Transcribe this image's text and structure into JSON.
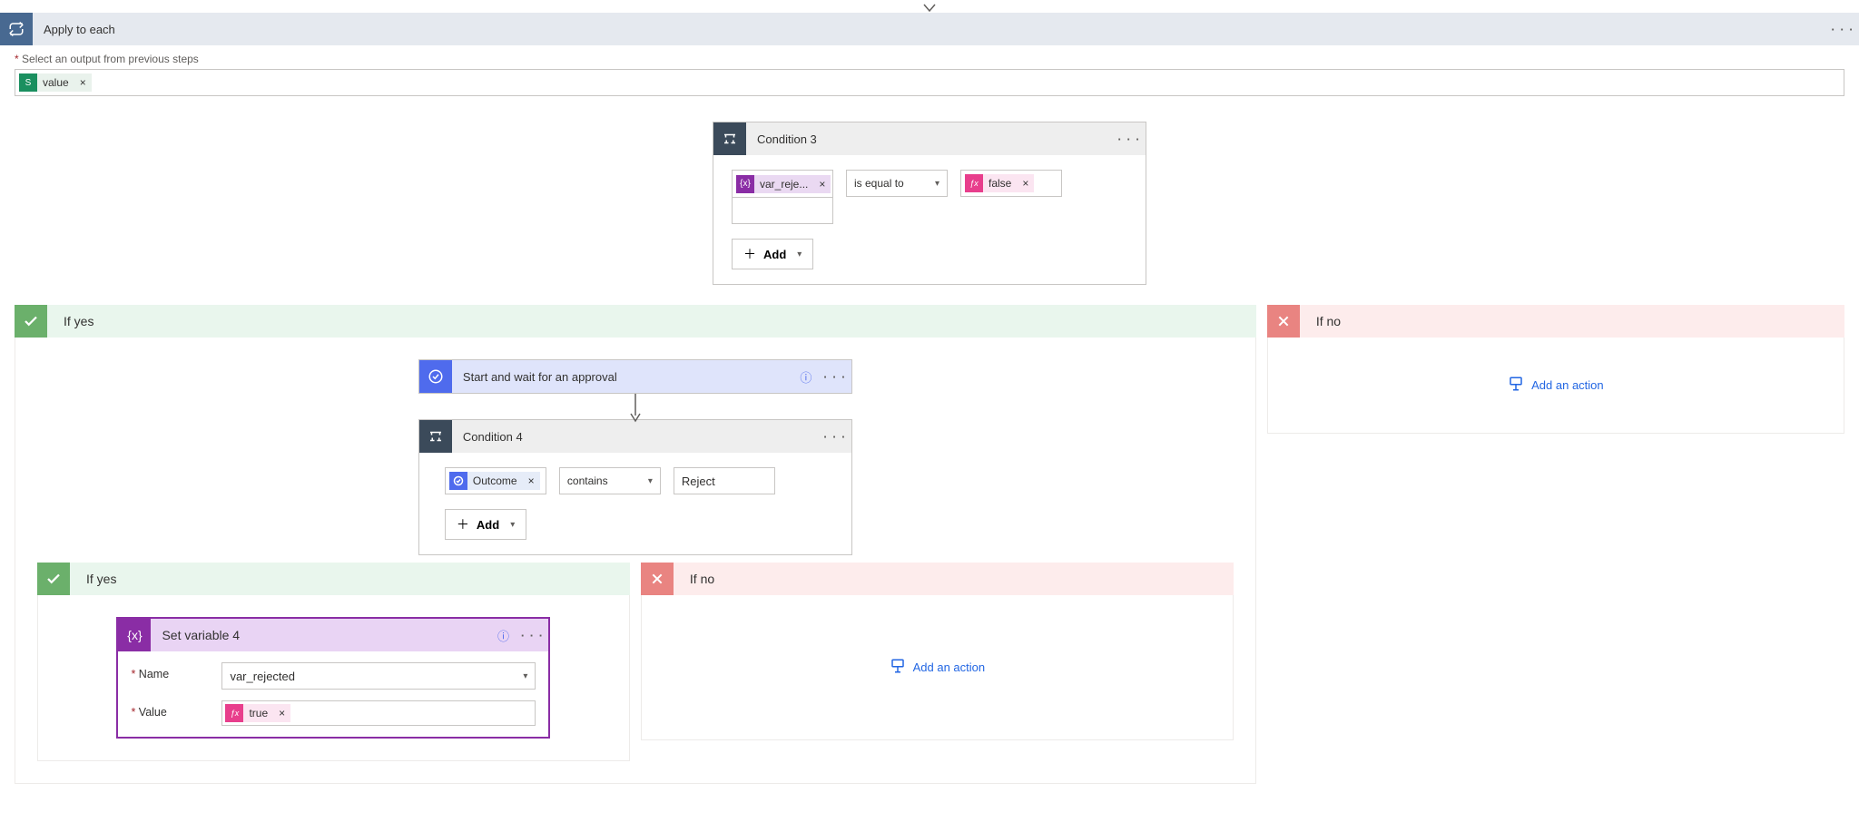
{
  "applyToEach": {
    "title": "Apply to each",
    "selectOutputLabel": "Select an output from previous steps",
    "outputToken": "value"
  },
  "condition3": {
    "title": "Condition 3",
    "leftToken": "var_reje...",
    "operator": "is equal to",
    "rightToken": "false",
    "addLabel": "Add"
  },
  "branchYes": "If yes",
  "branchNo": "If no",
  "approval": {
    "title": "Start and wait for an approval"
  },
  "condition4": {
    "title": "Condition 4",
    "leftToken": "Outcome",
    "operator": "contains",
    "rightValue": "Reject",
    "addLabel": "Add"
  },
  "setVariable": {
    "title": "Set variable 4",
    "nameLabel": "Name",
    "nameValue": "var_rejected",
    "valueLabel": "Value",
    "valueToken": "true"
  },
  "addAction": "Add an action"
}
